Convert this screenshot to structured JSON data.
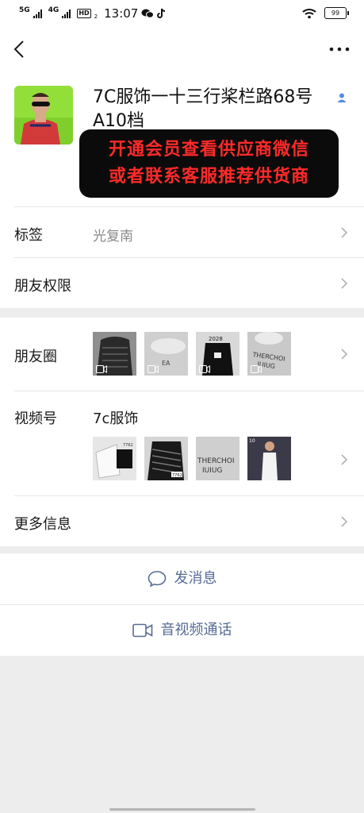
{
  "status_bar": {
    "net1": "5G",
    "net2": "4G",
    "hd": "HD",
    "hd_sub": "2",
    "time": "13:07",
    "battery": "99"
  },
  "profile": {
    "name": "7C服饰一十三行桨栏路68号A10档",
    "banner_line1": "开通会员查看供应商微信",
    "banner_line2": "或者联系客服推荐供货商"
  },
  "tags": {
    "label": "标签",
    "value": "光复南"
  },
  "friend_permissions": {
    "label": "朋友权限"
  },
  "moments": {
    "label": "朋友圈"
  },
  "channels": {
    "label": "视频号",
    "name": "7c服饰"
  },
  "more_info": {
    "label": "更多信息"
  },
  "actions": {
    "send_message": "发消息",
    "video_call": "音视频通话"
  },
  "colors": {
    "link": "#576b95",
    "banner_text": "#ff2a2a",
    "page_bg": "#ededed"
  }
}
